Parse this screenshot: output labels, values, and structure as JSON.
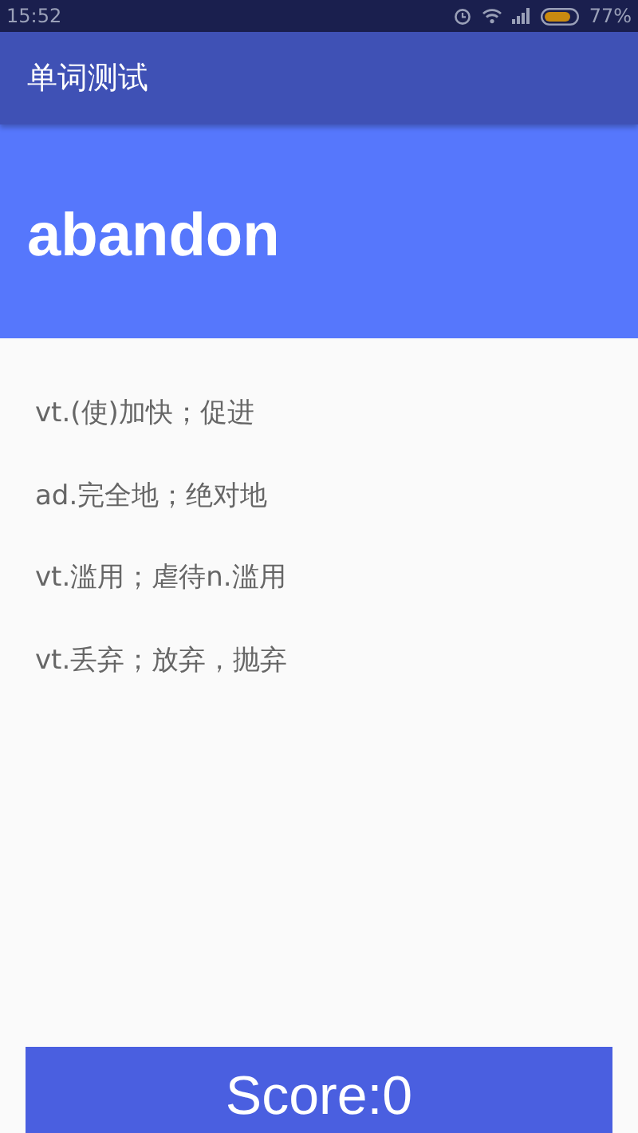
{
  "status_bar": {
    "time": "15:52",
    "battery": "77%"
  },
  "app_bar": {
    "title": "单词测试"
  },
  "word": "abandon",
  "options": [
    {
      "text": "vt.(使)加快；促进"
    },
    {
      "text": "ad.完全地；绝对地"
    },
    {
      "text": "vt.滥用；虐待n.滥用"
    },
    {
      "text": "vt.丢弃；放弃，抛弃"
    }
  ],
  "score_button": {
    "label": "Score:0"
  }
}
